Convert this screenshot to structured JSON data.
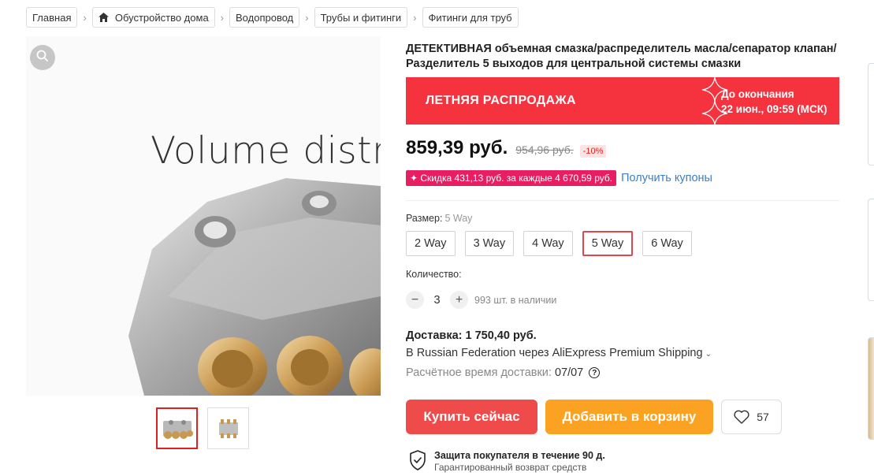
{
  "breadcrumb": [
    {
      "label": "Главная"
    },
    {
      "label": "Обустройство дома",
      "icon": "home-icon"
    },
    {
      "label": "Водопровод"
    },
    {
      "label": "Трубы и фитинги"
    },
    {
      "label": "Фитинги для труб"
    }
  ],
  "gallery": {
    "image_caption": "Volume distrib",
    "zoom_icon": "magnifier-icon",
    "thumbnails": [
      {
        "label": "main"
      },
      {
        "label": "diagram"
      }
    ],
    "active_thumbnail": 1
  },
  "product": {
    "title": "ДЕТЕКТИВНАЯ объемная смазка/распределитель масла/сепаратор клапан/Разделитель 5 выходов для центральной системы смазки"
  },
  "promo": {
    "name": "ЛЕТНЯЯ РАСПРОДАЖА",
    "deadline_line1": "До окончания",
    "deadline_line2": "22 июн., 09:59 (МСК)",
    "color": "#f5333f"
  },
  "price": {
    "current": "859,39 руб.",
    "old": "954,96 руб.",
    "discount": "-10%"
  },
  "coupon": {
    "badge": "✦ Скидка 431,13 руб. за каждые 4 670,59 руб.",
    "link": "Получить купоны"
  },
  "size": {
    "label": "Размер:",
    "selected": "5 Way",
    "options": [
      "2 Way",
      "3 Way",
      "4 Way",
      "5 Way",
      "6 Way"
    ]
  },
  "quantity": {
    "label": "Количество:",
    "value": "3",
    "minus": "−",
    "plus": "+",
    "stock": "993 шт. в наличии"
  },
  "shipping": {
    "title": "Доставка: 1 750,40 руб.",
    "via": "В Russian Federation через AliExpress Premium Shipping",
    "eta_label": "Расчётное время доставки:",
    "eta_date": "07/07",
    "help_icon": "?"
  },
  "actions": {
    "buy": "Купить сейчас",
    "cart": "Добавить в корзину",
    "wishlist_count": "57",
    "buy_color": "#f04b4b",
    "cart_color": "#fca223"
  },
  "protection": {
    "title": "Защита покупателя в течение 90 д.",
    "subtitle": "Гарантированный возврат средств",
    "icon": "shield-check-icon"
  }
}
